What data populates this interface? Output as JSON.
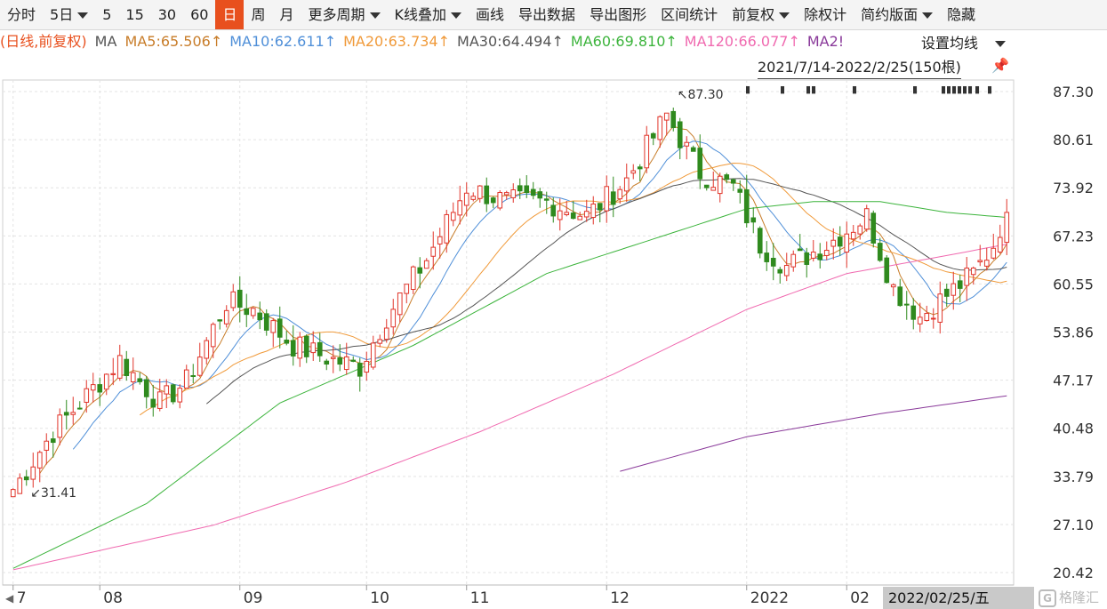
{
  "toolbar": {
    "items": [
      {
        "label": "分时",
        "dropdown": false,
        "active": false
      },
      {
        "label": "5日",
        "dropdown": true,
        "active": false
      },
      {
        "label": "5",
        "dropdown": false,
        "active": false
      },
      {
        "label": "15",
        "dropdown": false,
        "active": false
      },
      {
        "label": "30",
        "dropdown": false,
        "active": false
      },
      {
        "label": "60",
        "dropdown": false,
        "active": false
      },
      {
        "label": "日",
        "dropdown": false,
        "active": true
      },
      {
        "label": "周",
        "dropdown": false,
        "active": false
      },
      {
        "label": "月",
        "dropdown": false,
        "active": false
      },
      {
        "label": "更多周期",
        "dropdown": true,
        "active": false
      },
      {
        "label": "K线叠加",
        "dropdown": true,
        "active": false
      },
      {
        "label": "画线",
        "dropdown": false,
        "active": false
      },
      {
        "label": "导出数据",
        "dropdown": false,
        "active": false
      },
      {
        "label": "导出图形",
        "dropdown": false,
        "active": false
      },
      {
        "label": "区间统计",
        "dropdown": false,
        "active": false
      },
      {
        "label": "前复权",
        "dropdown": true,
        "active": false
      },
      {
        "label": "除权计",
        "dropdown": false,
        "active": false
      },
      {
        "label": "简约版面",
        "dropdown": true,
        "active": false
      },
      {
        "label": "隐藏",
        "dropdown": false,
        "active": false
      }
    ]
  },
  "legend": {
    "prefix": {
      "text": "(日线,前复权)",
      "color": "#e8501e"
    },
    "ma_label": {
      "text": "MA",
      "color": "#555555"
    },
    "items": [
      {
        "text": "MA5:65.506↑",
        "color": "#c87d2a"
      },
      {
        "text": "MA10:62.611↑",
        "color": "#4f8fd8"
      },
      {
        "text": "MA20:63.734↑",
        "color": "#f09a3a"
      },
      {
        "text": "MA30:64.494↑",
        "color": "#555555"
      },
      {
        "text": "MA60:69.810↑",
        "color": "#3cb43c"
      },
      {
        "text": "MA120:66.077↑",
        "color": "#f06ab0"
      },
      {
        "text": "MA2!",
        "color": "#8a3a9a"
      }
    ]
  },
  "settings": {
    "label": "设置均线"
  },
  "range": {
    "label": "2021/7/14-2022/2/25(150根)"
  },
  "date_box": {
    "label": "2022/02/25/五"
  },
  "logo": {
    "icon": "G",
    "text": "格隆汇"
  },
  "colors": {
    "up": "#e0352b",
    "down": "#2f8a1e",
    "grid": "#e3e3e3",
    "axis": "#999999"
  },
  "chart_data": {
    "type": "candlestick",
    "y_ticks": [
      "87.30",
      "80.61",
      "73.92",
      "67.23",
      "60.55",
      "53.86",
      "47.17",
      "40.48",
      "33.79",
      "27.10",
      "20.42"
    ],
    "ylim": [
      20.42,
      87.3
    ],
    "x_ticks": [
      {
        "label": "7",
        "index": 0
      },
      {
        "label": "08",
        "index": 13
      },
      {
        "label": "09",
        "index": 34
      },
      {
        "label": "10",
        "index": 53
      },
      {
        "label": "11",
        "index": 68
      },
      {
        "label": "12",
        "index": 89
      },
      {
        "label": "2022",
        "index": 110
      },
      {
        "label": "02",
        "index": 125
      }
    ],
    "count": 150,
    "annotations": [
      {
        "text": "87.30",
        "index": 98,
        "value": 87.3
      },
      {
        "text": "31.41",
        "index": 1,
        "value": 31.41
      }
    ],
    "high": 87.3,
    "low": 31.41,
    "last_close": 70.5,
    "ma_last": {
      "MA5": 65.506,
      "MA10": 62.611,
      "MA20": 63.734,
      "MA30": 64.494,
      "MA60": 69.81,
      "MA120": 66.077
    },
    "ma250_start_index": 91,
    "ma250_range": [
      34.5,
      45.0
    ]
  }
}
